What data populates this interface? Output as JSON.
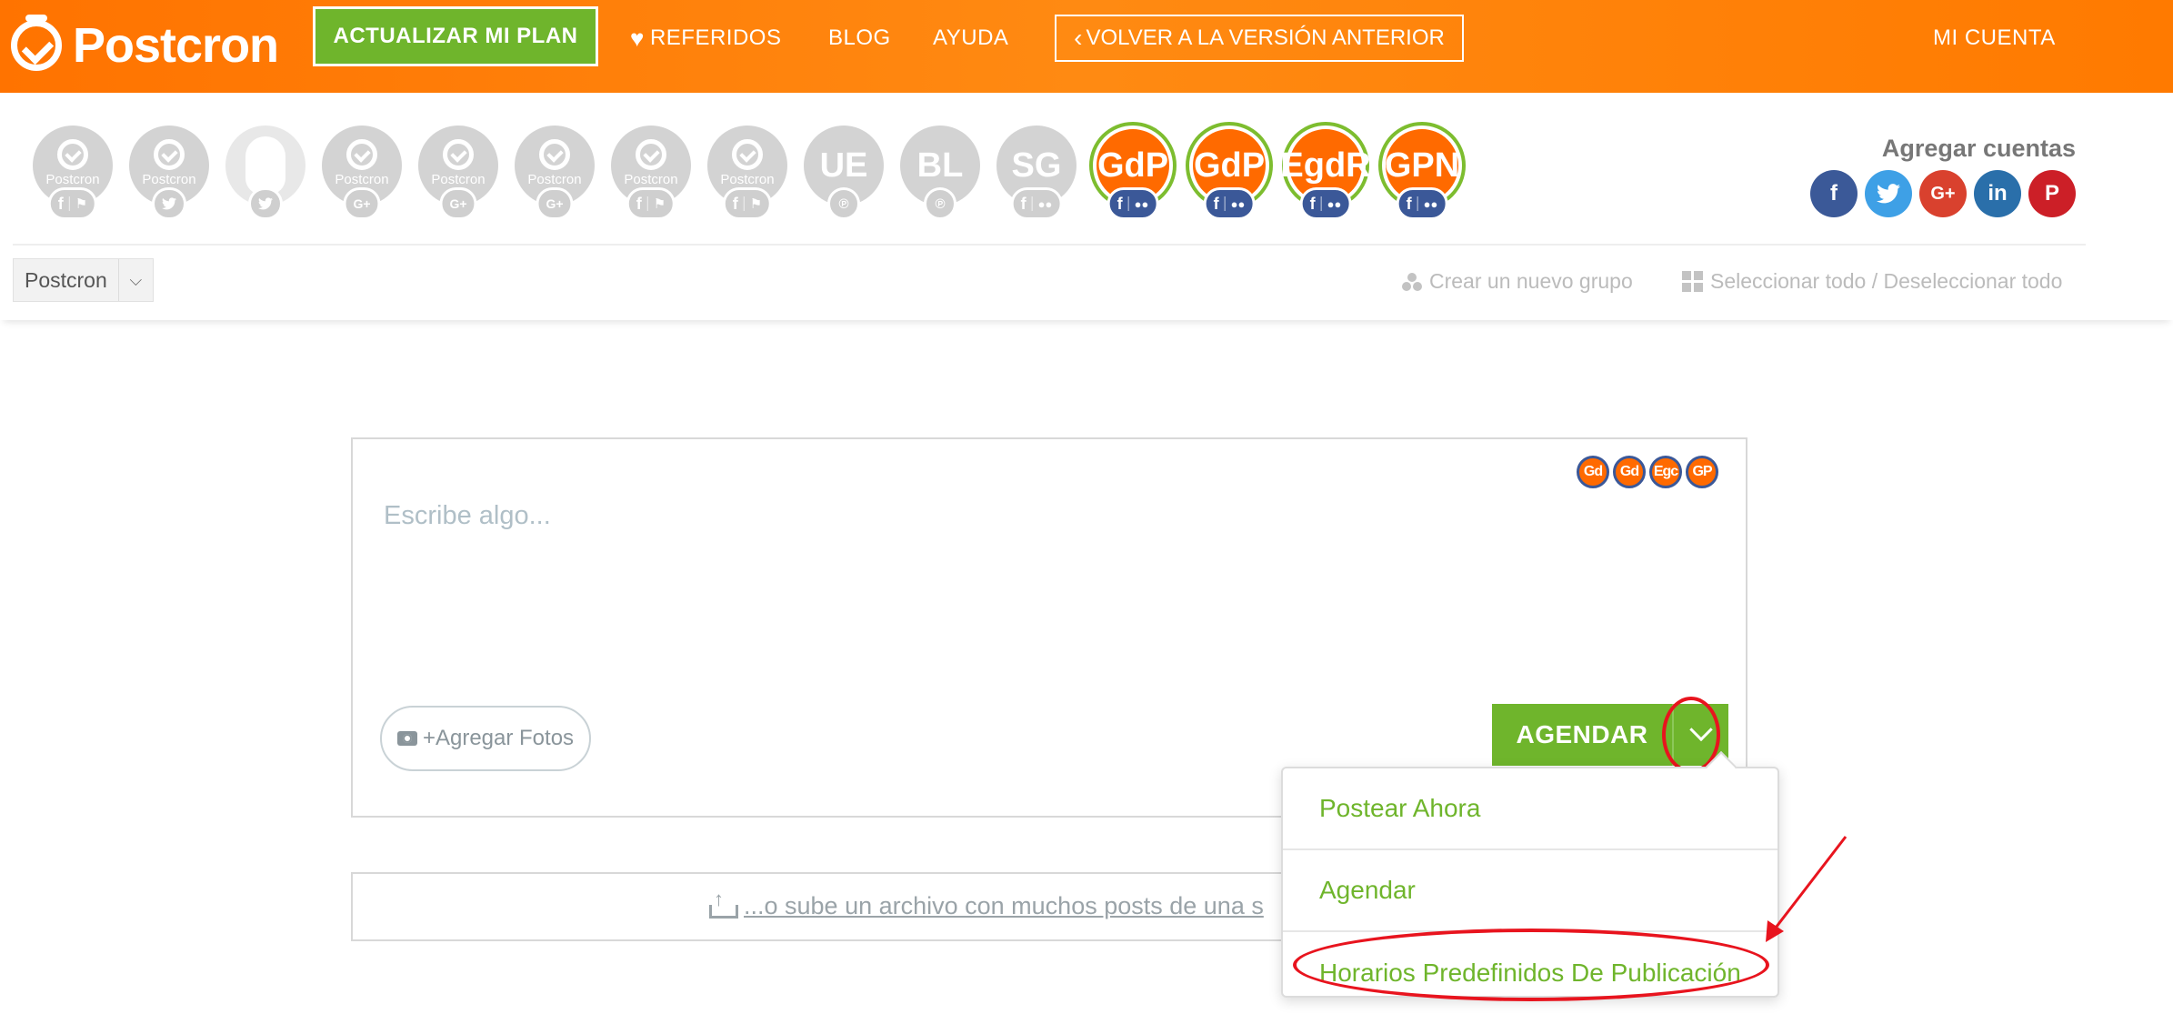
{
  "topbar": {
    "logo_text": "Postcron",
    "upgrade_label": "ACTUALIZAR MI PLAN",
    "referrals_label": "REFERIDOS",
    "blog_label": "BLOG",
    "help_label": "AYUDA",
    "back_label": "VOLVER A LA VERSIÓN ANTERIOR",
    "account_label": "MI CUENTA",
    "colors": {
      "bar": "#ff7a00",
      "upgrade": "#6fb52c"
    }
  },
  "accounts": [
    {
      "initials": "",
      "caption": "Postcron",
      "type": "logo",
      "badges": "f | ⚑",
      "active": false
    },
    {
      "initials": "",
      "caption": "Postcron",
      "type": "logo",
      "badges": "twitter",
      "active": false
    },
    {
      "initials": "",
      "caption": "",
      "type": "ghost",
      "badges": "twitter",
      "active": false
    },
    {
      "initials": "",
      "caption": "Postcron",
      "type": "logo",
      "badges": "G+",
      "active": false
    },
    {
      "initials": "",
      "caption": "Postcron",
      "type": "logo",
      "badges": "G+",
      "active": false
    },
    {
      "initials": "",
      "caption": "Postcron",
      "type": "logo",
      "badges": "G+",
      "active": false
    },
    {
      "initials": "",
      "caption": "Postcron",
      "type": "logo",
      "badges": "f | ⚑",
      "active": false
    },
    {
      "initials": "",
      "caption": "Postcron",
      "type": "logo",
      "badges": "f | ⚑",
      "active": false
    },
    {
      "initials": "UE",
      "caption": "",
      "type": "text",
      "badges": "pinterest",
      "active": false
    },
    {
      "initials": "BL",
      "caption": "",
      "type": "text",
      "badges": "pinterest",
      "active": false
    },
    {
      "initials": "SG",
      "caption": "",
      "type": "text",
      "badges": "f | group",
      "active": false
    },
    {
      "initials": "GdP",
      "caption": "",
      "type": "text",
      "badges": "f | group",
      "active": true
    },
    {
      "initials": "GdP",
      "caption": "",
      "type": "text",
      "badges": "f | group",
      "active": true
    },
    {
      "initials": "EgdR",
      "caption": "",
      "type": "text",
      "badges": "f | group",
      "active": true
    },
    {
      "initials": "GPN",
      "caption": "",
      "type": "text",
      "badges": "f | group",
      "active": true
    }
  ],
  "add_accounts": {
    "title": "Agregar cuentas",
    "networks": [
      "f",
      "t",
      "G+",
      "in",
      "P"
    ]
  },
  "group": {
    "selected": "Postcron",
    "create_label": "Crear un nuevo grupo",
    "select_all_label": "Seleccionar todo / Deseleccionar todo"
  },
  "composer": {
    "placeholder": "Escribe algo...",
    "selected_accounts": [
      "Gd",
      "Gd",
      "Egc",
      "GP"
    ],
    "add_photos_label": "+Agregar Fotos",
    "schedule_label": "AGENDAR"
  },
  "upload": {
    "label": "...o sube un archivo con muchos posts de una s"
  },
  "schedule_menu": {
    "items": [
      "Postear Ahora",
      "Agendar",
      "Horarios Predefinidos De Publicación"
    ],
    "color": "#6fb52c"
  },
  "annotations": {
    "color": "#e8141e"
  }
}
